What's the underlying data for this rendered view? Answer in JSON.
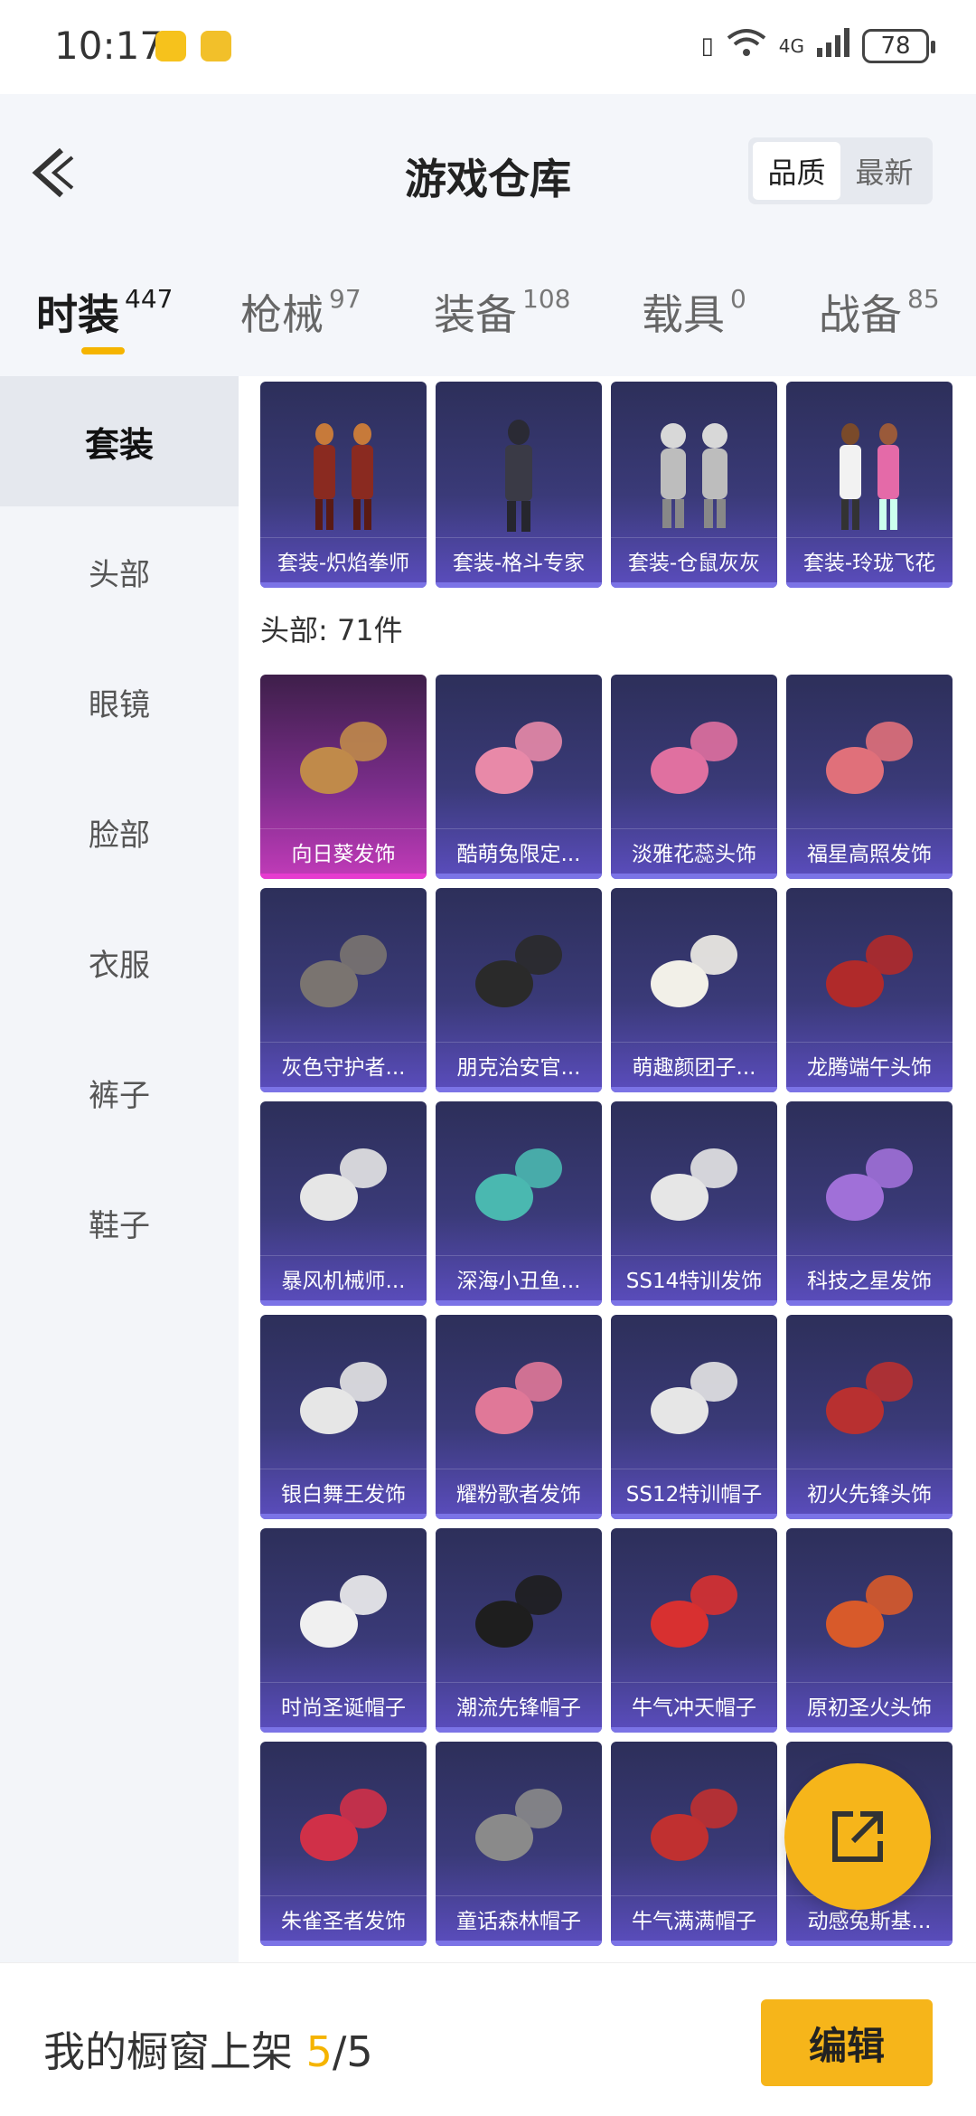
{
  "status_bar": {
    "time": "10:17",
    "network": "4G",
    "battery": "78"
  },
  "header": {
    "title": "游戏仓库",
    "sort_options": [
      "品质",
      "最新"
    ],
    "selected_sort": "品质"
  },
  "tabs": [
    {
      "label": "时装",
      "count": "447",
      "active": true
    },
    {
      "label": "枪械",
      "count": "97"
    },
    {
      "label": "装备",
      "count": "108"
    },
    {
      "label": "载具",
      "count": "0"
    },
    {
      "label": "战备",
      "count": "85"
    }
  ],
  "sidebar": {
    "items": [
      "套装",
      "头部",
      "眼镜",
      "脸部",
      "衣服",
      "裤子",
      "鞋子"
    ],
    "active": "套装"
  },
  "outfits": [
    "套装-炽焰拳师",
    "套装-格斗专家",
    "套装-仓鼠灰灰",
    "套装-玲珑飞花"
  ],
  "head_section_label": "头部: 71件",
  "head_items": [
    "向日葵发饰",
    "酷萌兔限定...",
    "淡雅花蕊头饰",
    "福星高照发饰",
    "灰色守护者...",
    "朋克治安官...",
    "萌趣颜团子...",
    "龙腾端午头饰",
    "暴风机械师...",
    "深海小丑鱼...",
    "SS14特训发饰",
    "科技之星发饰",
    "银白舞王发饰",
    "耀粉歌者发饰",
    "SS12特训帽子",
    "初火先锋头饰",
    "时尚圣诞帽子",
    "潮流先锋帽子",
    "牛气冲天帽子",
    "原初圣火头饰",
    "朱雀圣者发饰",
    "童话森林帽子",
    "牛气满满帽子",
    "动感兔斯基..."
  ],
  "bottom": {
    "label": "我的橱窗上架",
    "current": "5",
    "total": "/5",
    "edit_label": "编辑"
  },
  "colors": {
    "accent": "#f6b51a",
    "card_bg": "#3a3a78",
    "highlight_card": "#c23bb9"
  }
}
